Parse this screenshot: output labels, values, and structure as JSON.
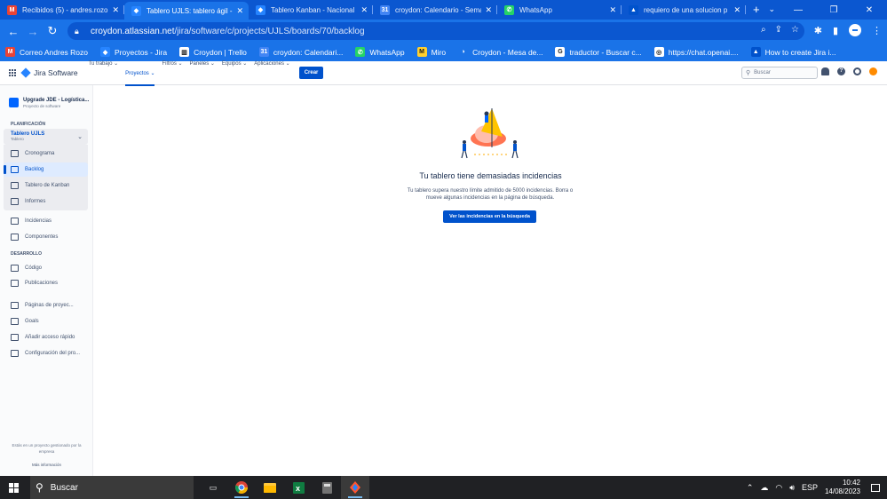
{
  "browser": {
    "tabs": [
      {
        "title": "Recibidos (5) - andres.rozo@",
        "icon": "gmail-icon",
        "color": "#ea4335",
        "glyph": "M",
        "active": false
      },
      {
        "title": "Tablero UJLS: tablero ágil -",
        "icon": "jira-icon",
        "color": "#2684ff",
        "glyph": "◆",
        "active": true
      },
      {
        "title": "Tablero Kanban - Nacional",
        "icon": "jira-icon",
        "color": "#2684ff",
        "glyph": "◆",
        "active": false
      },
      {
        "title": "croydon: Calendario - Sema",
        "icon": "calendar-icon",
        "color": "#4285f4",
        "glyph": "31",
        "active": false
      },
      {
        "title": "WhatsApp",
        "icon": "whatsapp-icon",
        "color": "#25d366",
        "glyph": "✆",
        "active": false
      },
      {
        "title": "requiero de una solucion p",
        "icon": "atlassian-icon",
        "color": "#0052cc",
        "glyph": "▲",
        "active": false
      }
    ],
    "url_host": "croydon.atlassian.net",
    "url_path": "/jira/software/c/projects/UJLS/boards/70/backlog",
    "bookmarks": [
      {
        "label": "Correo Andres Rozo",
        "color": "#ea4335",
        "glyph": "M"
      },
      {
        "label": "Proyectos - Jira",
        "color": "#2684ff",
        "glyph": "◆"
      },
      {
        "label": "Croydon | Trello",
        "color": "#ffffff",
        "glyph": "▥"
      },
      {
        "label": "croydon: Calendari...",
        "color": "#4285f4",
        "glyph": "31"
      },
      {
        "label": "WhatsApp",
        "color": "#25d366",
        "glyph": "✆"
      },
      {
        "label": "Miro",
        "color": "#ffd02f",
        "glyph": "M"
      },
      {
        "label": "Croydon - Mesa de...",
        "color": "#1a73e8",
        "glyph": "◑"
      },
      {
        "label": "traductor - Buscar c...",
        "color": "#ffffff",
        "glyph": "G"
      },
      {
        "label": "https://chat.openai....",
        "color": "#ffffff",
        "glyph": "◎"
      },
      {
        "label": "How to create Jira i...",
        "color": "#0052cc",
        "glyph": "▲"
      }
    ]
  },
  "jira": {
    "product": "Jira Software",
    "menu": [
      "Tu trabajo ⌄",
      "Proyectos ⌄",
      "Filtros ⌄",
      "Paneles ⌄",
      "Equipos ⌄",
      "Aplicaciones ⌄"
    ],
    "create": "Crear",
    "search_placeholder": "Buscar"
  },
  "sidebar": {
    "project_name": "Upgrade JDE - Logística...",
    "project_type": "Proyecto de software",
    "planning_heading": "PLANIFICACIÓN",
    "board_name": "Tablero UJLS",
    "board_type": "Tablero",
    "board_items": [
      {
        "label": "Cronograma",
        "active": false
      },
      {
        "label": "Backlog",
        "active": true
      },
      {
        "label": "Tablero de Kanban",
        "active": false
      },
      {
        "label": "Informes",
        "active": false
      }
    ],
    "items": [
      "Incidencias",
      "Componentes"
    ],
    "dev_heading": "DESARROLLO",
    "dev_items": [
      "Código",
      "Publicaciones"
    ],
    "other_items": [
      "Páginas de proyec...",
      "Goals",
      "Añadir acceso rápido",
      "Configuración del pro..."
    ],
    "footer_text": "Estás en un proyecto gestionado por la empresa",
    "footer_link": "Más información"
  },
  "main": {
    "title": "Tu tablero tiene demasiadas incidencias",
    "description": "Tu tablero supera nuestro límite admitido de 5000 incidencias. Borra o mueve algunas incidencias en la página de búsqueda.",
    "button": "Ver las incidencias en la búsqueda"
  },
  "taskbar": {
    "search": "Buscar",
    "lang": "ESP",
    "time": "10:42",
    "date": "14/08/2023"
  }
}
